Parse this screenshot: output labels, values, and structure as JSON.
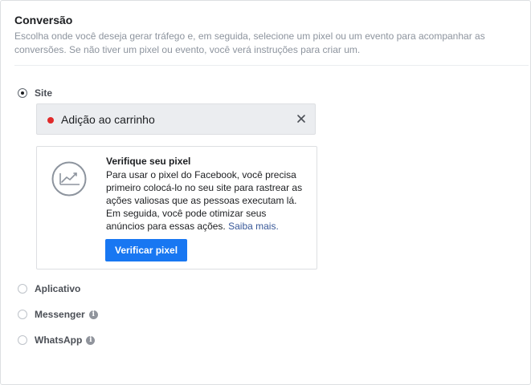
{
  "section": {
    "title": "Conversão",
    "description": "Escolha onde você deseja gerar tráfego e, em seguida, selecione um pixel ou um evento para acompanhar as conversões. Se não tiver um pixel ou evento, você verá instruções para criar um."
  },
  "options": [
    {
      "label": "Site",
      "checked": true
    },
    {
      "label": "Aplicativo",
      "checked": false
    },
    {
      "label": "Messenger",
      "checked": false,
      "info": true
    },
    {
      "label": "WhatsApp",
      "checked": false,
      "info": true
    }
  ],
  "selected_event": {
    "label": "Adição ao carrinho",
    "status_color": "#e02a2a"
  },
  "pixel_card": {
    "title": "Verifique seu pixel",
    "body": "Para usar o pixel do Facebook, você precisa primeiro colocá-lo no seu site para rastrear as ações valiosas que as pessoas executam lá. Em seguida, você pode otimizar seus anúncios para essas ações.",
    "link": "Saiba mais.",
    "button_label": "Verificar pixel",
    "icon": "chart-line-icon"
  },
  "colors": {
    "accent": "#1877f2",
    "link": "#385898",
    "muted": "#8d949e"
  }
}
